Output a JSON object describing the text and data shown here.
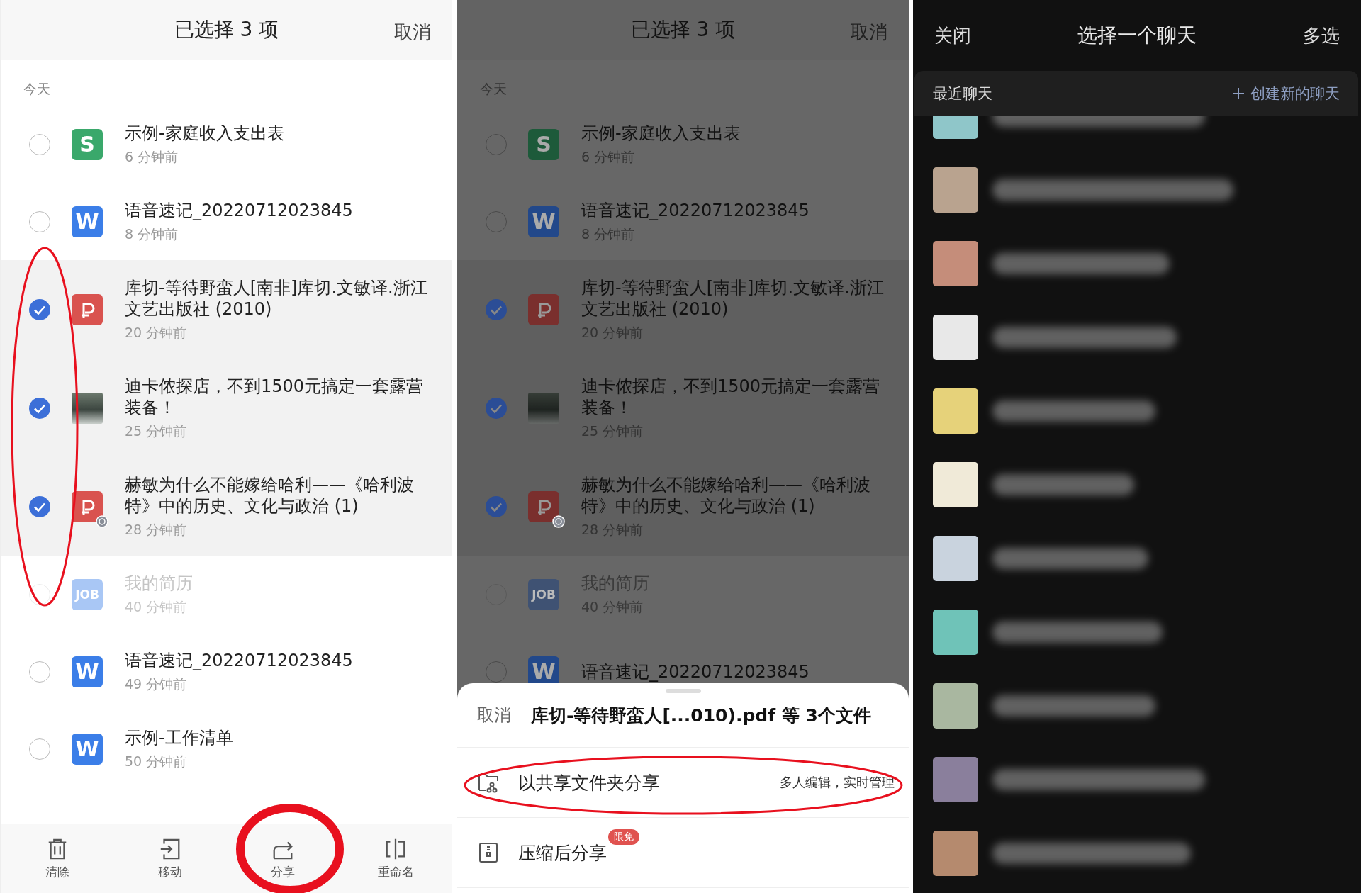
{
  "file_browser": {
    "title": "已选择 3 项",
    "cancel": "取消",
    "section": "今天",
    "files": [
      {
        "kind": "sheet",
        "icon_text": "S",
        "name": "示例-家庭收入支出表",
        "time": "6 分钟前",
        "selected": false,
        "disabled": false,
        "shared": false
      },
      {
        "kind": "doc",
        "icon_text": "W",
        "name": "语音速记_20220712023845",
        "time": "8 分钟前",
        "selected": false,
        "disabled": false,
        "shared": false
      },
      {
        "kind": "pdf",
        "name": "库切-等待野蛮人[南非]库切.文敏译.浙江文艺出版社 (2010)",
        "time": "20 分钟前",
        "selected": true,
        "disabled": false,
        "shared": false
      },
      {
        "kind": "image",
        "name": "迪卡侬探店，不到1500元搞定一套露营装备！",
        "time": "25 分钟前",
        "selected": true,
        "disabled": false,
        "shared": false
      },
      {
        "kind": "pdf",
        "name": "赫敏为什么不能嫁给哈利——《哈利波特》中的历史、文化与政治 (1)",
        "time": "28 分钟前",
        "selected": true,
        "disabled": false,
        "shared": true
      },
      {
        "kind": "job",
        "icon_text": "JOB",
        "name": "我的简历",
        "time": "40 分钟前",
        "selected": false,
        "disabled": true,
        "shared": false
      },
      {
        "kind": "doc",
        "icon_text": "W",
        "name": "语音速记_20220712023845",
        "time": "49 分钟前",
        "selected": false,
        "disabled": false,
        "shared": false
      },
      {
        "kind": "doc",
        "icon_text": "W",
        "name": "示例-工作清单",
        "time": "50 分钟前",
        "selected": false,
        "disabled": false,
        "shared": false
      }
    ],
    "toolbar": [
      {
        "kind": "trash",
        "label": "清除"
      },
      {
        "kind": "move",
        "label": "移动"
      },
      {
        "kind": "share",
        "label": "分享"
      },
      {
        "kind": "rename",
        "label": "重命名"
      }
    ]
  },
  "share_view": {
    "title": "已选择 3 项",
    "cancel": "取消",
    "section": "今天",
    "files": [
      {
        "kind": "sheet",
        "icon_text": "S",
        "name": "示例-家庭收入支出表",
        "time": "6 分钟前",
        "selected": false,
        "disabled": false,
        "shared": false
      },
      {
        "kind": "doc",
        "icon_text": "W",
        "name": "语音速记_20220712023845",
        "time": "8 分钟前",
        "selected": false,
        "disabled": false,
        "shared": false
      },
      {
        "kind": "pdf",
        "name": "库切-等待野蛮人[南非]库切.文敏译.浙江文艺出版社 (2010)",
        "time": "20 分钟前",
        "selected": true,
        "disabled": false,
        "shared": false
      },
      {
        "kind": "image",
        "name": "迪卡侬探店，不到1500元搞定一套露营装备！",
        "time": "25 分钟前",
        "selected": true,
        "disabled": false,
        "shared": false
      },
      {
        "kind": "pdf",
        "name": "赫敏为什么不能嫁给哈利——《哈利波特》中的历史、文化与政治 (1)",
        "time": "28 分钟前",
        "selected": true,
        "disabled": false,
        "shared": true
      },
      {
        "kind": "job",
        "icon_text": "JOB",
        "name": "我的简历",
        "time": "40 分钟前",
        "selected": false,
        "disabled": true,
        "shared": false
      },
      {
        "kind": "doc",
        "icon_text": "W",
        "name": "语音速记_20220712023845",
        "selected": false,
        "disabled": false,
        "shared": false
      }
    ],
    "sheet": {
      "cancel": "取消",
      "title": "库切-等待野蛮人[...010).pdf 等 3个文件",
      "options": [
        {
          "kind": "shared-folder",
          "label": "以共享文件夹分享",
          "note": "多人编辑，实时管理"
        },
        {
          "kind": "zip",
          "label": "压缩后分享",
          "badge": "限免"
        }
      ]
    }
  },
  "chat_picker": {
    "close": "关闭",
    "title": "选择一个聊天",
    "multi_select": "多选",
    "section": "最近聊天",
    "create": "创建新的聊天"
  }
}
